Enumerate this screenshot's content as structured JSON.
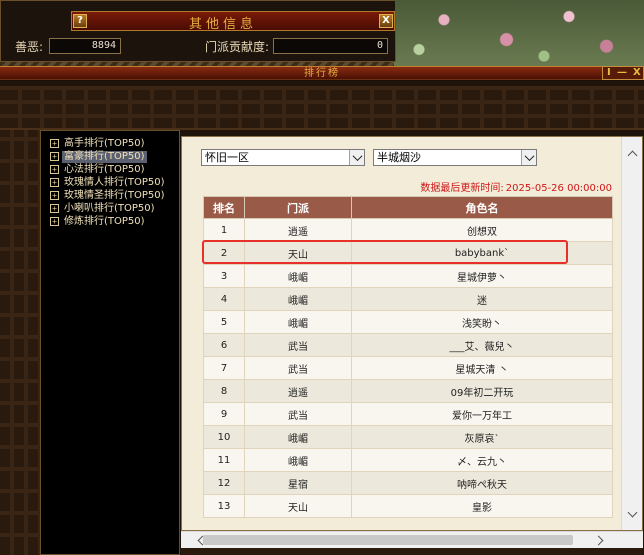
{
  "info_panel": {
    "title": "其他信息",
    "help_label": "?",
    "close_label": "X",
    "fields": [
      {
        "label": "善恶:",
        "value": "8894"
      },
      {
        "label": "门派贡献度:",
        "value": "0"
      }
    ]
  },
  "ranking_window": {
    "title": "排行榜",
    "controls": {
      "restore": "I",
      "minimize": "—",
      "close": "X"
    }
  },
  "categories": [
    {
      "plus": "+",
      "label": "高手排行(TOP50)"
    },
    {
      "plus": "+",
      "label": "富豪排行(TOP50)",
      "selected": true
    },
    {
      "plus": "+",
      "label": "心法排行(TOP50)"
    },
    {
      "plus": "+",
      "label": "玫瑰情人排行(TOP50)"
    },
    {
      "plus": "+",
      "label": "玫瑰情圣排行(TOP50)"
    },
    {
      "plus": "+",
      "label": "小喇叭排行(TOP50)"
    },
    {
      "plus": "+",
      "label": "修炼排行(TOP50)"
    }
  ],
  "filters": {
    "region": "怀旧一区",
    "server": "半城烟沙"
  },
  "update": {
    "label": "数据最后更新时间:",
    "time": "2025-05-26 00:00:00"
  },
  "table": {
    "headers": [
      "排名",
      "门派",
      "角色名"
    ],
    "rows": [
      {
        "rank": "1",
        "sect": "逍遥",
        "name": "创想双"
      },
      {
        "rank": "2",
        "sect": "天山",
        "name": "babybank`"
      },
      {
        "rank": "3",
        "sect": "峨嵋",
        "name": "星城伊萝丶"
      },
      {
        "rank": "4",
        "sect": "峨嵋",
        "name": "迷"
      },
      {
        "rank": "5",
        "sect": "峨嵋",
        "name": "浅笑盼丶"
      },
      {
        "rank": "6",
        "sect": "武当",
        "name": "___艾、薇兒丶"
      },
      {
        "rank": "7",
        "sect": "武当",
        "name": "星城天清 丶"
      },
      {
        "rank": "8",
        "sect": "逍遥",
        "name": "09年初二开玩"
      },
      {
        "rank": "9",
        "sect": "武当",
        "name": "爱你一万年工"
      },
      {
        "rank": "10",
        "sect": "峨嵋",
        "name": "灰原哀`"
      },
      {
        "rank": "11",
        "sect": "峨嵋",
        "name": "〆、云九丶"
      },
      {
        "rank": "12",
        "sect": "星宿",
        "name": "呐啼ぺ秋天"
      },
      {
        "rank": "13",
        "sect": "天山",
        "name": "皇影"
      }
    ]
  },
  "icons": {
    "dropdown": "chevron-down-icon",
    "scroll_up": "chevron-up-icon",
    "scroll_down": "chevron-down-icon",
    "scroll_left": "chevron-left-icon",
    "scroll_right": "chevron-right-icon",
    "expand": "plus-box-icon"
  },
  "colors": {
    "header_bg": "#9a5a48",
    "update_text": "#d01818",
    "highlight": "#e8302a",
    "title_gold": "#e8b040"
  }
}
